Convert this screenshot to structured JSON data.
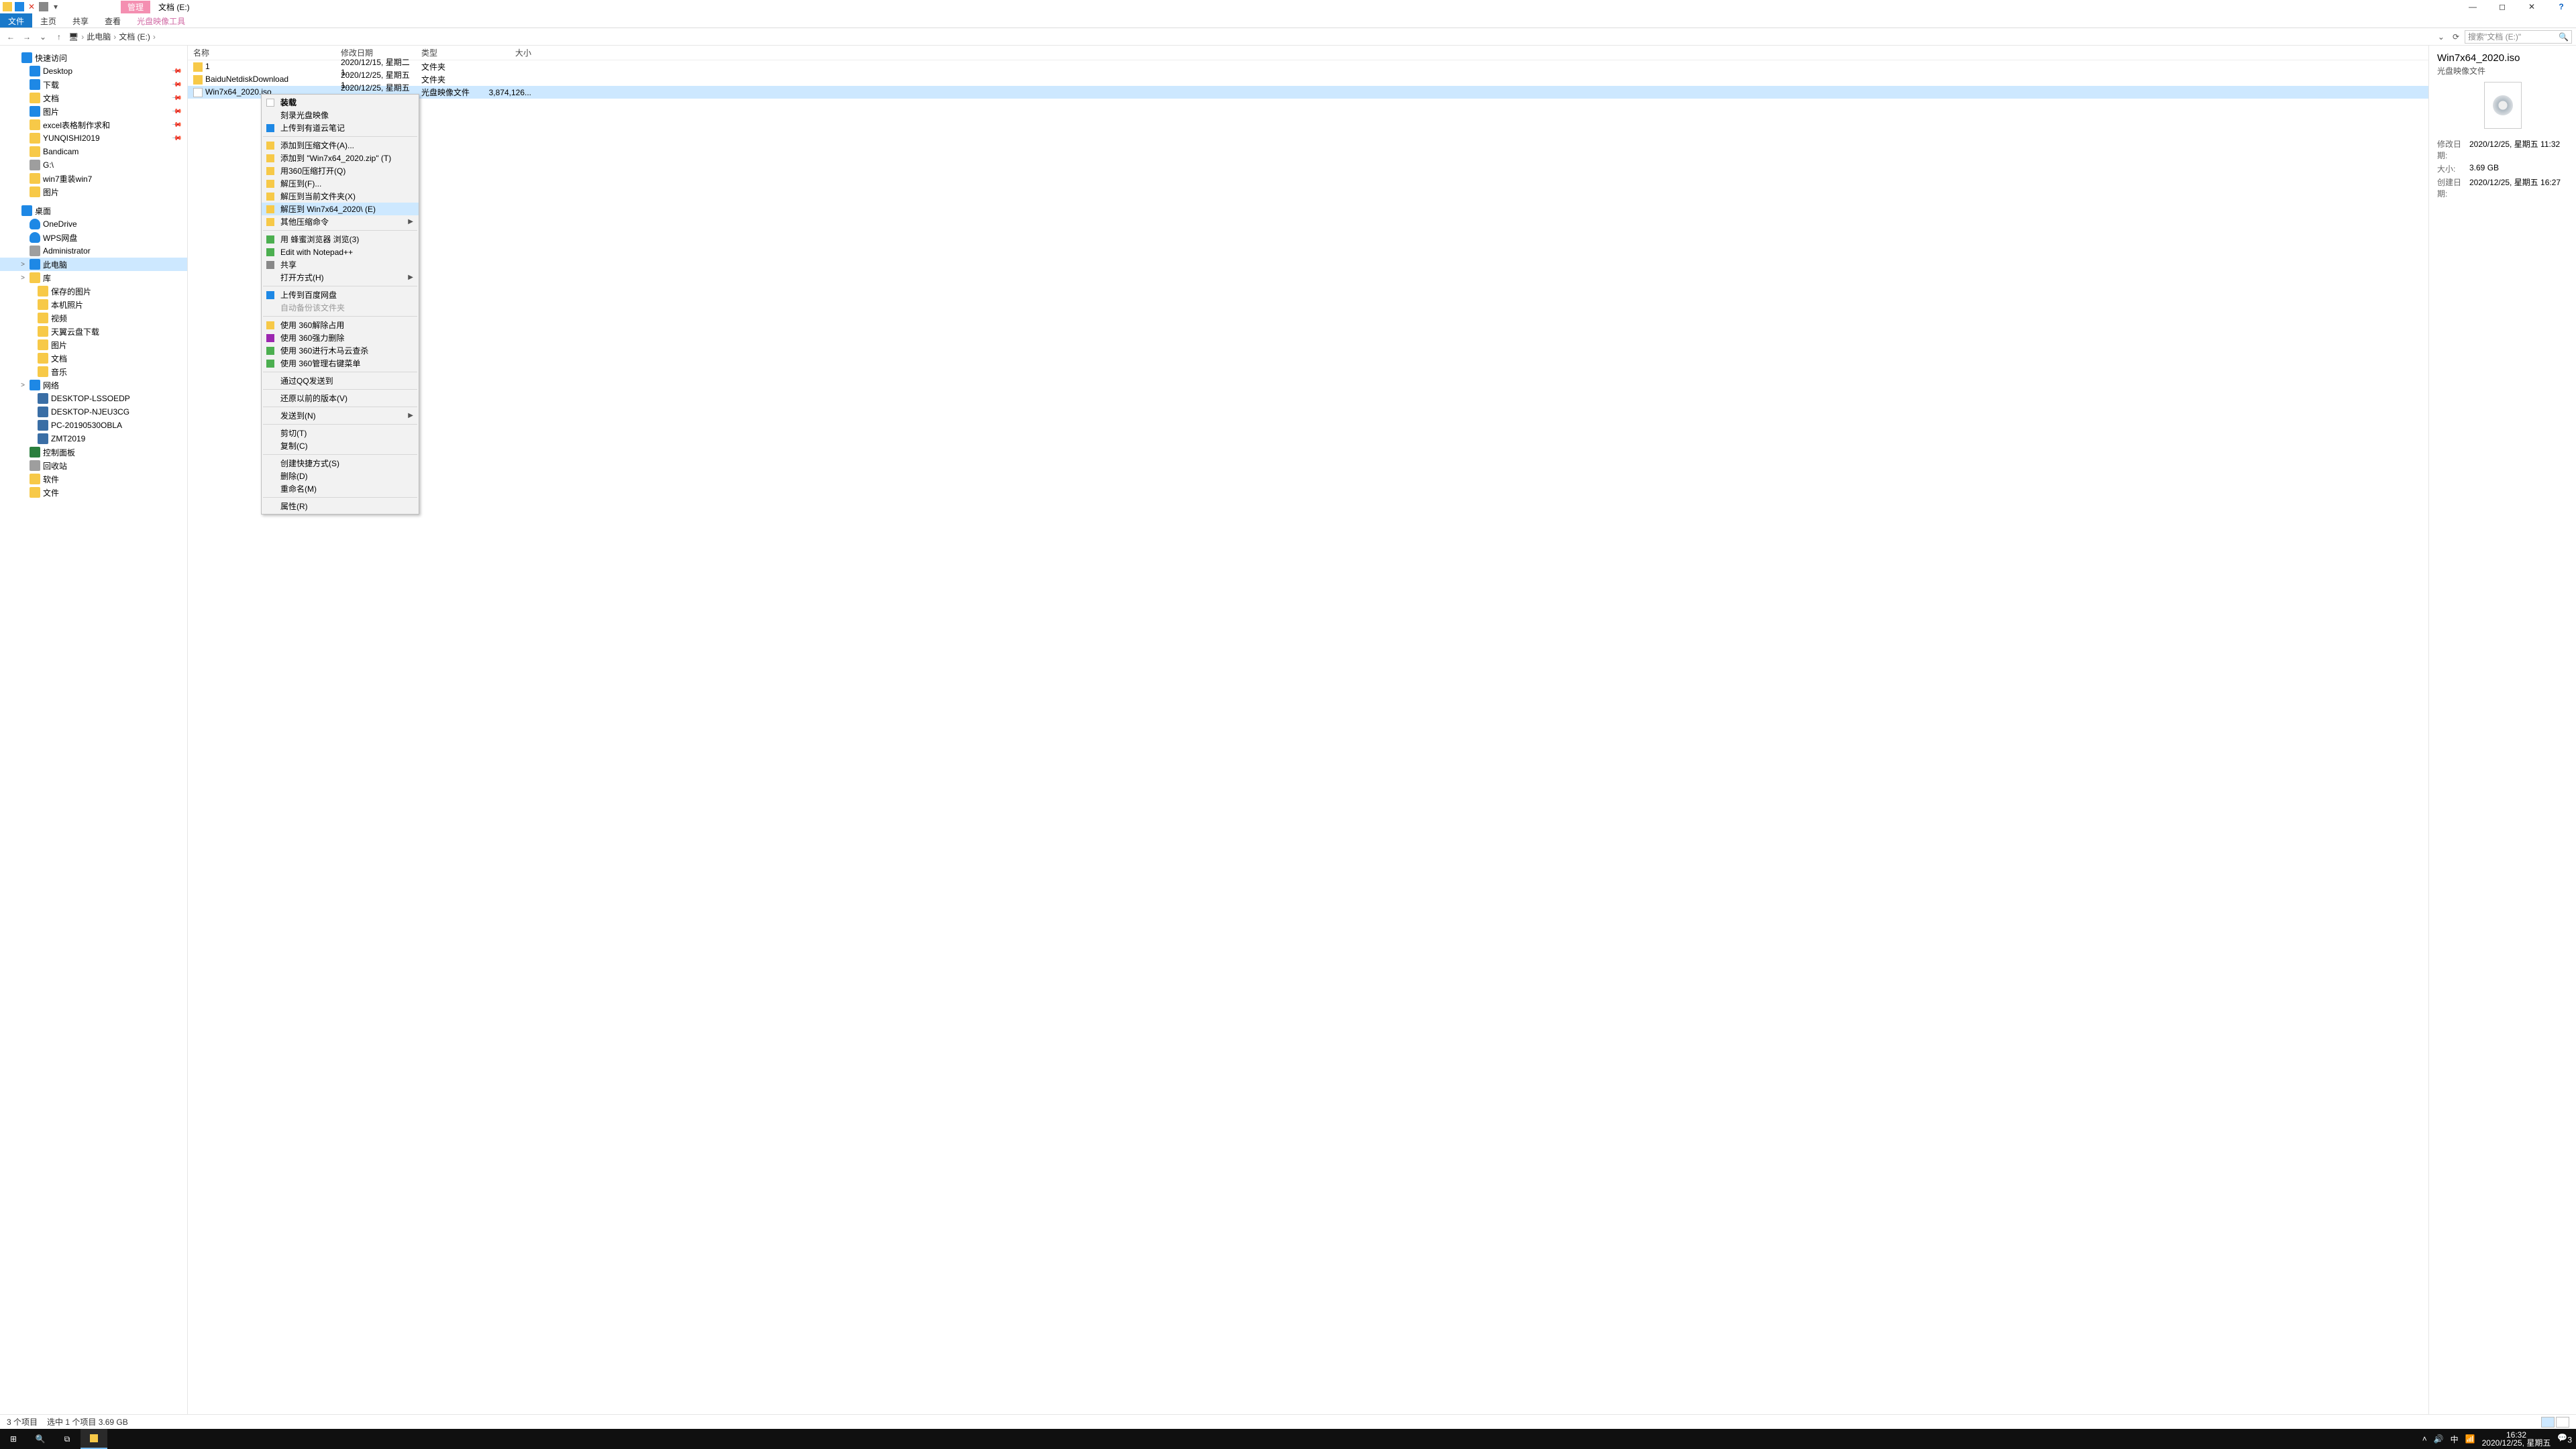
{
  "window": {
    "ribbon_context": "管理",
    "title": "文档 (E:)",
    "tabs": {
      "file": "文件",
      "home": "主页",
      "share": "共享",
      "view": "查看",
      "disc": "光盘映像工具"
    }
  },
  "nav": {
    "back": "←",
    "fwd": "→",
    "up": "↑"
  },
  "breadcrumb": [
    "此电脑",
    "文档 (E:)"
  ],
  "address_dropdown": "⌄",
  "refresh": "⟳",
  "search": {
    "placeholder": "搜索\"文档 (E:)\""
  },
  "tree": [
    {
      "ind": 16,
      "tw": "",
      "ic": "star",
      "label": "快速访问"
    },
    {
      "ind": 28,
      "tw": "",
      "ic": "blue",
      "label": "Desktop",
      "pin": true
    },
    {
      "ind": 28,
      "tw": "",
      "ic": "blue",
      "label": "下载",
      "pin": true
    },
    {
      "ind": 28,
      "tw": "",
      "ic": "y",
      "label": "文档",
      "pin": true
    },
    {
      "ind": 28,
      "tw": "",
      "ic": "blue",
      "label": "图片",
      "pin": true
    },
    {
      "ind": 28,
      "tw": "",
      "ic": "y",
      "label": "excel表格制作求和",
      "pin": true
    },
    {
      "ind": 28,
      "tw": "",
      "ic": "y",
      "label": "YUNQISHI2019",
      "pin": true
    },
    {
      "ind": 28,
      "tw": "",
      "ic": "y",
      "label": "Bandicam"
    },
    {
      "ind": 28,
      "tw": "",
      "ic": "gray",
      "label": "G:\\"
    },
    {
      "ind": 28,
      "tw": "",
      "ic": "y",
      "label": "win7重装win7"
    },
    {
      "ind": 28,
      "tw": "",
      "ic": "y",
      "label": "图片"
    },
    {
      "spacer": true
    },
    {
      "ind": 16,
      "tw": "",
      "ic": "blue",
      "label": "桌面"
    },
    {
      "ind": 28,
      "tw": "",
      "ic": "cloud",
      "label": "OneDrive"
    },
    {
      "ind": 28,
      "tw": "",
      "ic": "cloud",
      "label": "WPS网盘"
    },
    {
      "ind": 28,
      "tw": "",
      "ic": "gray",
      "label": "Administrator"
    },
    {
      "ind": 28,
      "tw": ">",
      "ic": "blue",
      "label": "此电脑",
      "sel": true
    },
    {
      "ind": 28,
      "tw": ">",
      "ic": "y",
      "label": "库"
    },
    {
      "ind": 40,
      "tw": "",
      "ic": "y",
      "label": "保存的图片"
    },
    {
      "ind": 40,
      "tw": "",
      "ic": "y",
      "label": "本机照片"
    },
    {
      "ind": 40,
      "tw": "",
      "ic": "y",
      "label": "视频"
    },
    {
      "ind": 40,
      "tw": "",
      "ic": "y",
      "label": "天翼云盘下载"
    },
    {
      "ind": 40,
      "tw": "",
      "ic": "y",
      "label": "图片"
    },
    {
      "ind": 40,
      "tw": "",
      "ic": "y",
      "label": "文档"
    },
    {
      "ind": 40,
      "tw": "",
      "ic": "y",
      "label": "音乐"
    },
    {
      "ind": 28,
      "tw": ">",
      "ic": "blue",
      "label": "网络"
    },
    {
      "ind": 40,
      "tw": "",
      "ic": "mon",
      "label": "DESKTOP-LSSOEDP"
    },
    {
      "ind": 40,
      "tw": "",
      "ic": "mon",
      "label": "DESKTOP-NJEU3CG"
    },
    {
      "ind": 40,
      "tw": "",
      "ic": "mon",
      "label": "PC-20190530OBLA"
    },
    {
      "ind": 40,
      "tw": "",
      "ic": "mon",
      "label": "ZMT2019"
    },
    {
      "ind": 28,
      "tw": "",
      "ic": "ctrl",
      "label": "控制面板"
    },
    {
      "ind": 28,
      "tw": "",
      "ic": "gray",
      "label": "回收站"
    },
    {
      "ind": 28,
      "tw": "",
      "ic": "y",
      "label": "软件"
    },
    {
      "ind": 28,
      "tw": "",
      "ic": "y",
      "label": "文件"
    }
  ],
  "columns": {
    "name": "名称",
    "date": "修改日期",
    "type": "类型",
    "size": "大小"
  },
  "rows": [
    {
      "ic": "y",
      "name": "1",
      "date": "2020/12/15, 星期二 1...",
      "type": "文件夹",
      "size": ""
    },
    {
      "ic": "y",
      "name": "BaiduNetdiskDownload",
      "date": "2020/12/25, 星期五 1...",
      "type": "文件夹",
      "size": ""
    },
    {
      "ic": "file",
      "name": "Win7x64_2020.iso",
      "date": "2020/12/25, 星期五 1...",
      "type": "光盘映像文件",
      "size": "3,874,126...",
      "sel": true
    }
  ],
  "ctx": [
    {
      "t": "装载",
      "ic": "w",
      "bold": true
    },
    {
      "t": "刻录光盘映像"
    },
    {
      "t": "上传到有道云笔记",
      "ic": "b"
    },
    {
      "sep": true
    },
    {
      "t": "添加到压缩文件(A)...",
      "ic": "y"
    },
    {
      "t": "添加到 \"Win7x64_2020.zip\" (T)",
      "ic": "y"
    },
    {
      "t": "用360压缩打开(Q)",
      "ic": "y"
    },
    {
      "t": "解压到(F)...",
      "ic": "y"
    },
    {
      "t": "解压到当前文件夹(X)",
      "ic": "y"
    },
    {
      "t": "解压到 Win7x64_2020\\ (E)",
      "ic": "y",
      "hi": true
    },
    {
      "t": "其他压缩命令",
      "ic": "y",
      "sub": true
    },
    {
      "sep": true
    },
    {
      "t": "用 蜂蜜浏览器 浏览(3)",
      "ic": "g"
    },
    {
      "t": "Edit with Notepad++",
      "ic": "g"
    },
    {
      "t": "共享",
      "ic": "gr"
    },
    {
      "t": "打开方式(H)",
      "sub": true
    },
    {
      "sep": true
    },
    {
      "t": "上传到百度网盘",
      "ic": "b"
    },
    {
      "t": "自动备份该文件夹",
      "dis": true
    },
    {
      "sep": true
    },
    {
      "t": "使用 360解除占用",
      "ic": "y"
    },
    {
      "t": "使用 360强力删除",
      "ic": "p"
    },
    {
      "t": "使用 360进行木马云查杀",
      "ic": "g"
    },
    {
      "t": "使用 360管理右键菜单",
      "ic": "g"
    },
    {
      "sep": true
    },
    {
      "t": "通过QQ发送到"
    },
    {
      "sep": true
    },
    {
      "t": "还原以前的版本(V)"
    },
    {
      "sep": true
    },
    {
      "t": "发送到(N)",
      "sub": true
    },
    {
      "sep": true
    },
    {
      "t": "剪切(T)"
    },
    {
      "t": "复制(C)"
    },
    {
      "sep": true
    },
    {
      "t": "创建快捷方式(S)"
    },
    {
      "t": "删除(D)"
    },
    {
      "t": "重命名(M)"
    },
    {
      "sep": true
    },
    {
      "t": "属性(R)"
    }
  ],
  "details": {
    "title": "Win7x64_2020.iso",
    "subtitle": "光盘映像文件",
    "meta": [
      {
        "k": "修改日期:",
        "v": "2020/12/25, 星期五 11:32"
      },
      {
        "k": "大小:",
        "v": "3.69 GB"
      },
      {
        "k": "创建日期:",
        "v": "2020/12/25, 星期五 16:27"
      }
    ]
  },
  "status": {
    "count": "3 个项目",
    "sel": "选中 1 个项目  3.69 GB"
  },
  "tray": {
    "ime": "中",
    "time": "16:32",
    "date": "2020/12/25, 星期五",
    "badge": "3"
  }
}
